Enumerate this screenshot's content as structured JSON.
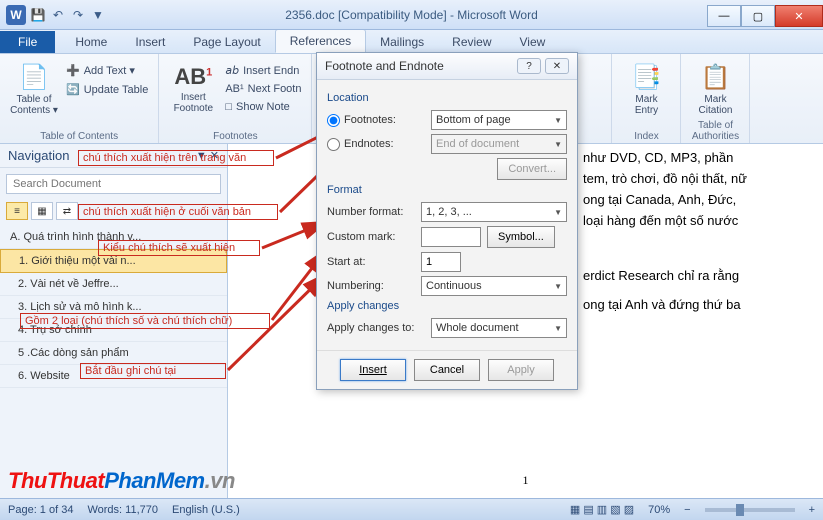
{
  "title": "2356.doc [Compatibility Mode] - Microsoft Word",
  "tabs": {
    "file": "File",
    "home": "Home",
    "insert": "Insert",
    "page_layout": "Page Layout",
    "references": "References",
    "mailings": "Mailings",
    "review": "Review",
    "view": "View"
  },
  "ribbon": {
    "toc": {
      "label": "Table of\nContents ▾",
      "add_text": "Add Text ▾",
      "update": "Update Table",
      "group": "Table of Contents"
    },
    "footnotes": {
      "label": "Insert\nFootnote",
      "insert_endnote": "Insert Endn",
      "next_footnote": "Next Footn",
      "show": "Show Note",
      "group": "Footnotes"
    },
    "index": {
      "mark_entry": "Mark\nEntry",
      "group": "Index"
    },
    "toa": {
      "mark_citation": "Mark\nCitation",
      "group": "Table of Authorities"
    }
  },
  "nav": {
    "title": "Navigation",
    "search_placeholder": "Search Document",
    "items": [
      "A. Quá trình hình thành v...",
      "1. Giới thiệu một vài n...",
      "2. Vài nét về Jeffre...",
      "3. Lịch sử và mô hình k...",
      "4. Trụ sở chính",
      "5 .Các dòng sản phẩm",
      "6. Website"
    ]
  },
  "doc": {
    "line1": "như DVD, CD, MP3, phần",
    "line2": "tem, trò chơi, đồ nội thất, nữ",
    "line3": "ong tại Canada, Anh, Đức,",
    "line4": "loại hàng đến một số nước",
    "line5": "erdict Research chỉ ra rằng",
    "line6": "ong tại Anh và đứng thứ ba",
    "pagenum": "1"
  },
  "dialog": {
    "title": "Footnote and Endnote",
    "location": "Location",
    "footnotes": "Footnotes:",
    "footnotes_val": "Bottom of page",
    "endnotes": "Endnotes:",
    "endnotes_val": "End of document",
    "convert": "Convert...",
    "format": "Format",
    "number_format": "Number format:",
    "number_format_val": "1, 2, 3, ...",
    "custom_mark": "Custom mark:",
    "symbol": "Symbol...",
    "start_at": "Start at:",
    "start_at_val": "1",
    "numbering": "Numbering:",
    "numbering_val": "Continuous",
    "apply_changes": "Apply changes",
    "apply_to": "Apply changes to:",
    "apply_to_val": "Whole document",
    "insert": "Insert",
    "cancel": "Cancel",
    "apply": "Apply"
  },
  "anno": {
    "a1": "chú thích xuất hiện trên trang văn",
    "a2": "chú thích xuất hiện ở cuối văn bản",
    "a3": "Kiểu chú thích sẽ xuất hiện",
    "a4": "Gồm 2 loại (chú thích số và chú thích chữ)",
    "a5": "Bắt đầu ghi chú tại"
  },
  "status": {
    "page": "Page: 1 of 34",
    "words": "Words: 11,770",
    "lang": "English (U.S.)",
    "zoom": "70%"
  },
  "watermark": {
    "a": "ThuThuat",
    "b": "PhanMem",
    "c": ".vn"
  }
}
